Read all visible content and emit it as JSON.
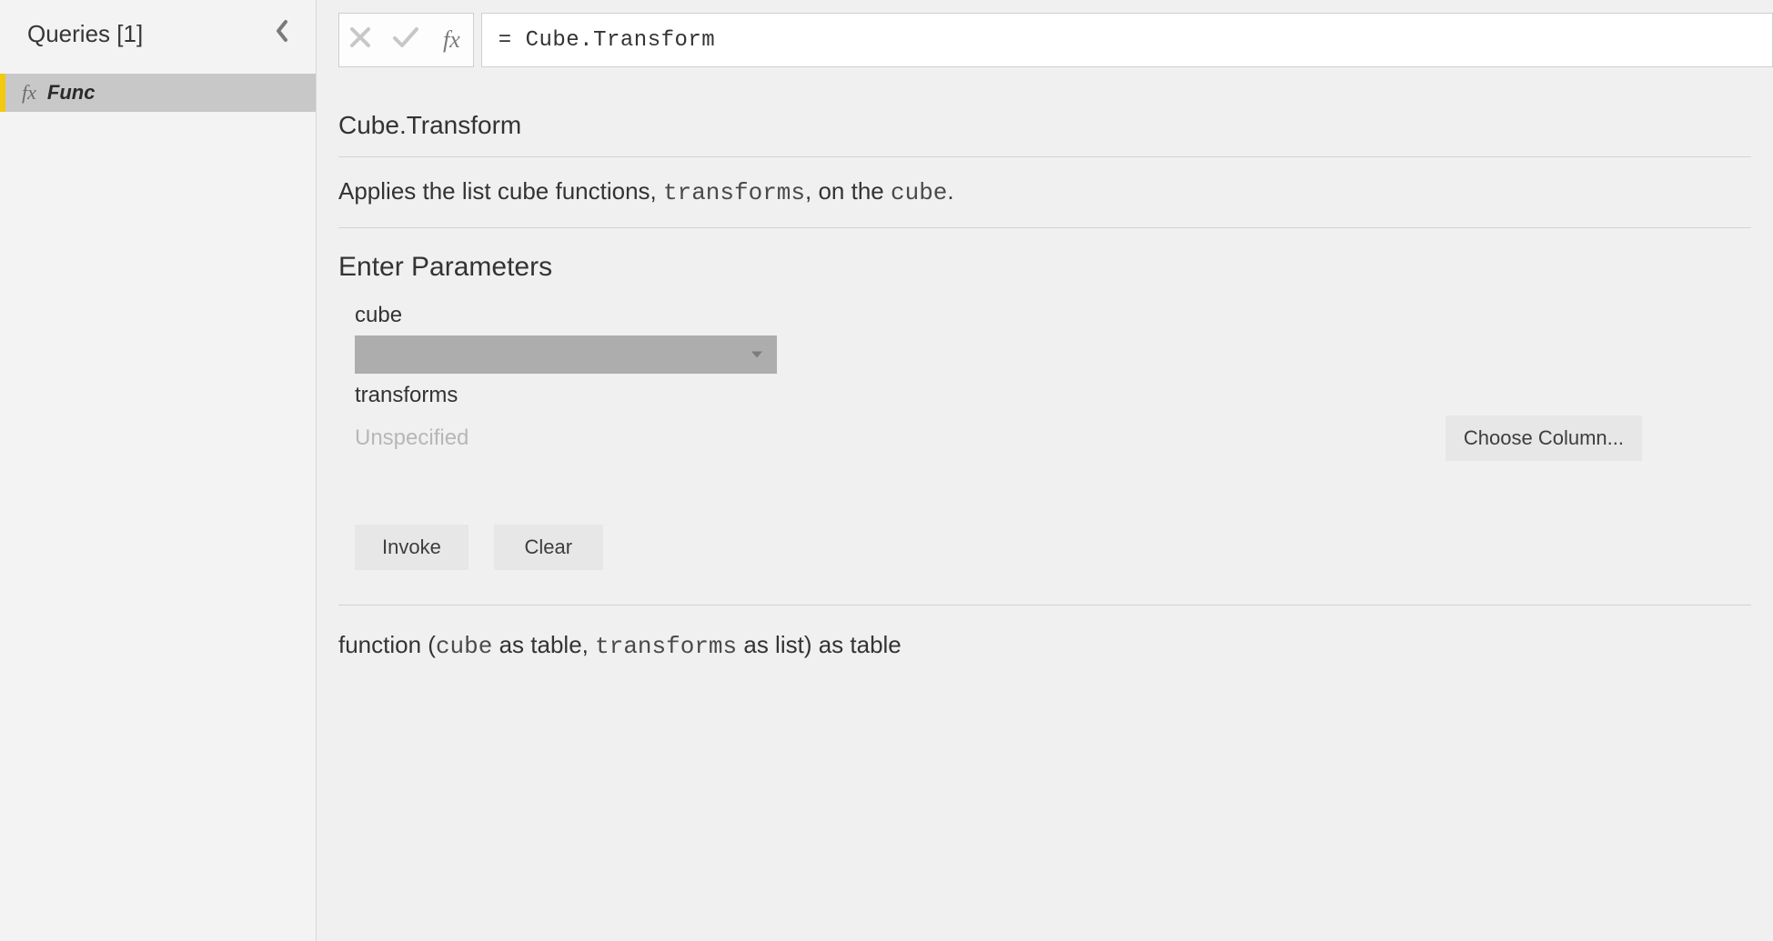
{
  "sidebar": {
    "title": "Queries [1]",
    "collapse_icon_label": "collapse",
    "items": [
      {
        "icon": "fx",
        "name": "Func"
      }
    ]
  },
  "formula_bar": {
    "cancel_icon": "✕",
    "confirm_icon": "✓",
    "fx_label": "fx",
    "value": "= Cube.Transform"
  },
  "function": {
    "name": "Cube.Transform",
    "description_pre": "Applies the list cube functions, ",
    "description_param1": "transforms",
    "description_mid": ", on the ",
    "description_param2": "cube",
    "description_post": "."
  },
  "parameters": {
    "title": "Enter Parameters",
    "items": [
      {
        "label": "cube",
        "type": "dropdown",
        "value": ""
      },
      {
        "label": "transforms",
        "type": "column",
        "value": "Unspecified",
        "choose_label": "Choose Column..."
      }
    ]
  },
  "actions": {
    "invoke": "Invoke",
    "clear": "Clear"
  },
  "signature": {
    "pre": "function (",
    "p1": "cube",
    "t1": " as table, ",
    "p2": "transforms",
    "t2": " as list) as table"
  }
}
